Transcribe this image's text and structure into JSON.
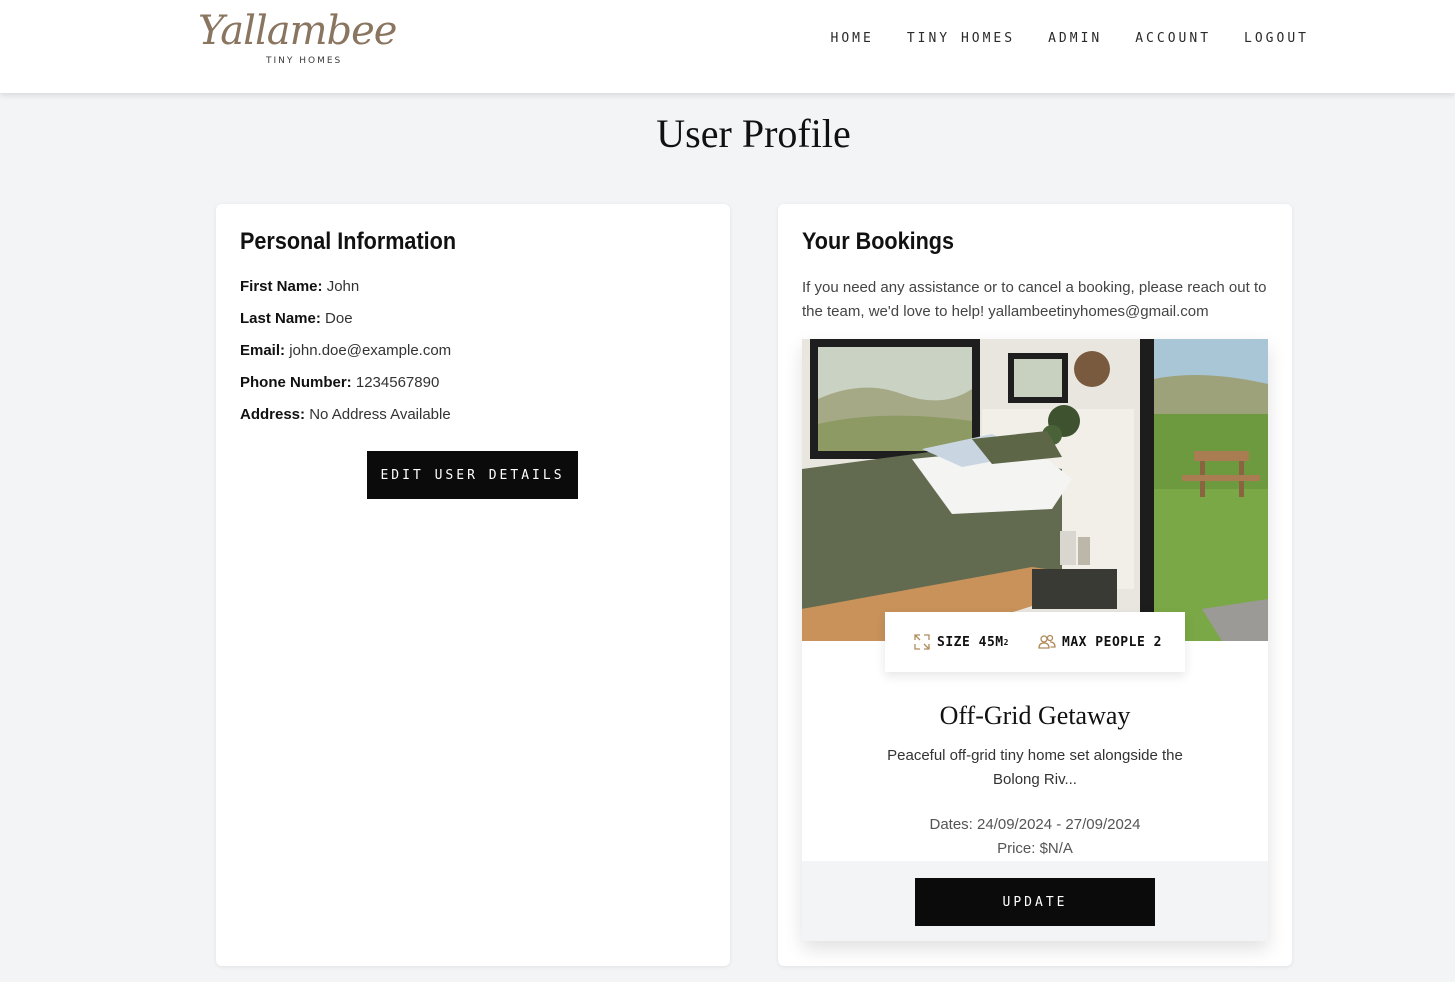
{
  "header": {
    "logo_script": "Yallambee",
    "logo_sub": "TINY HOMES",
    "nav": [
      "HOME",
      "TINY HOMES",
      "ADMIN",
      "ACCOUNT",
      "LOGOUT"
    ]
  },
  "page": {
    "title": "User Profile"
  },
  "personal": {
    "heading": "Personal Information",
    "fields": [
      {
        "label": "First Name:",
        "value": "John"
      },
      {
        "label": "Last Name:",
        "value": "Doe"
      },
      {
        "label": "Email:",
        "value": "john.doe@example.com"
      },
      {
        "label": "Phone Number:",
        "value": "1234567890"
      },
      {
        "label": "Address:",
        "value": "No Address Available"
      }
    ],
    "edit_button": "EDIT USER DETAILS"
  },
  "bookings": {
    "heading": "Your Bookings",
    "assist_text": "If you need any assistance or to cancel a booking, please reach out to the team, we'd love to help! yallambeetinyhomes@gmail.com",
    "items": [
      {
        "size_label": "SIZE 45M",
        "size_sup": "2",
        "people_label": "MAX PEOPLE 2",
        "title": "Off-Grid Getaway",
        "description": "Peaceful off-grid tiny home set alongside the Bolong Riv...",
        "dates": "Dates: 24/09/2024 - 27/09/2024",
        "price": "Price: $N/A",
        "update_button": "UPDATE"
      }
    ]
  },
  "colors": {
    "background": "#f3f4f6",
    "logo": "#8a7560",
    "button": "#0b0b0b",
    "icon_accent": "#b08a5a"
  }
}
